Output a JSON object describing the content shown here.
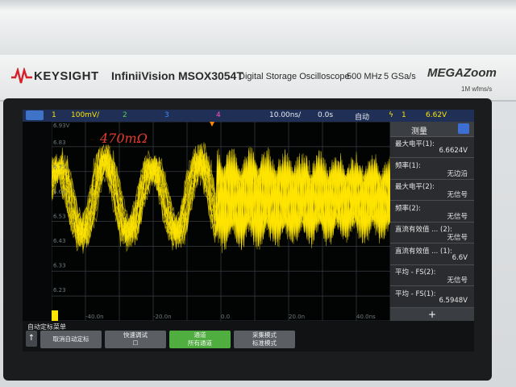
{
  "brand": {
    "company": "KEYSIGHT",
    "model": "InfiniiVision MSOX3054T",
    "description": "Digital Storage Oscilloscope",
    "bandwidth": "500 MHz",
    "sample_rate": "5 GSa/s",
    "megazoom": "MEGAZoom",
    "megazoom_sub": "1M wfms/s"
  },
  "status": {
    "ch1_num": "1",
    "ch1_scale": "100mV/",
    "ch2": "2",
    "ch3": "3",
    "ch4": "4",
    "timebase": "10.00ns/",
    "delay": "0.0s",
    "trigger_mode": "自动",
    "trig_source": "1",
    "trig_level": "6.62V"
  },
  "annotation": "470mΩ",
  "plot_labels": {
    "y_top": "6.93V",
    "y_labels": [
      "6.83",
      "6.73",
      "6.63",
      "6.53",
      "6.43",
      "6.33",
      "6.23"
    ],
    "x_labels": [
      "-40.0n",
      "-20.0n",
      "0.0",
      "20.0n",
      "40.0ns"
    ]
  },
  "side_panel": {
    "title": "测量",
    "items": [
      {
        "label": "最大电平(1):",
        "value": "6.6624V"
      },
      {
        "label": "频率(1):",
        "value": "无边沿"
      },
      {
        "label": "最大电平(2):",
        "value": "无信号"
      },
      {
        "label": "频率(2):",
        "value": "无信号"
      },
      {
        "label": "直流有效值 ... (2):",
        "value": "无信号"
      },
      {
        "label": "直流有效值 ... (1):",
        "value": "6.6V"
      },
      {
        "label": "平均 - FS(2):",
        "value": "无信号"
      },
      {
        "label": "平均 - FS(1):",
        "value": "6.5948V"
      }
    ],
    "add": "+"
  },
  "softkeys": {
    "menu_title": "自动定标菜单",
    "up": "↑",
    "buttons": [
      {
        "line1": "取消自动定标",
        "line2": ""
      },
      {
        "line1": "快速调试",
        "line2": "☐"
      },
      {
        "line1": "通道",
        "line2": "所有通道"
      },
      {
        "line1": "采集模式",
        "line2": "标准模式"
      }
    ]
  },
  "colors": {
    "trace": "#ffe600",
    "statusbar": "#1f2f55",
    "side_panel": "#2a2c2f",
    "softkey_active": "#4fae3f"
  }
}
